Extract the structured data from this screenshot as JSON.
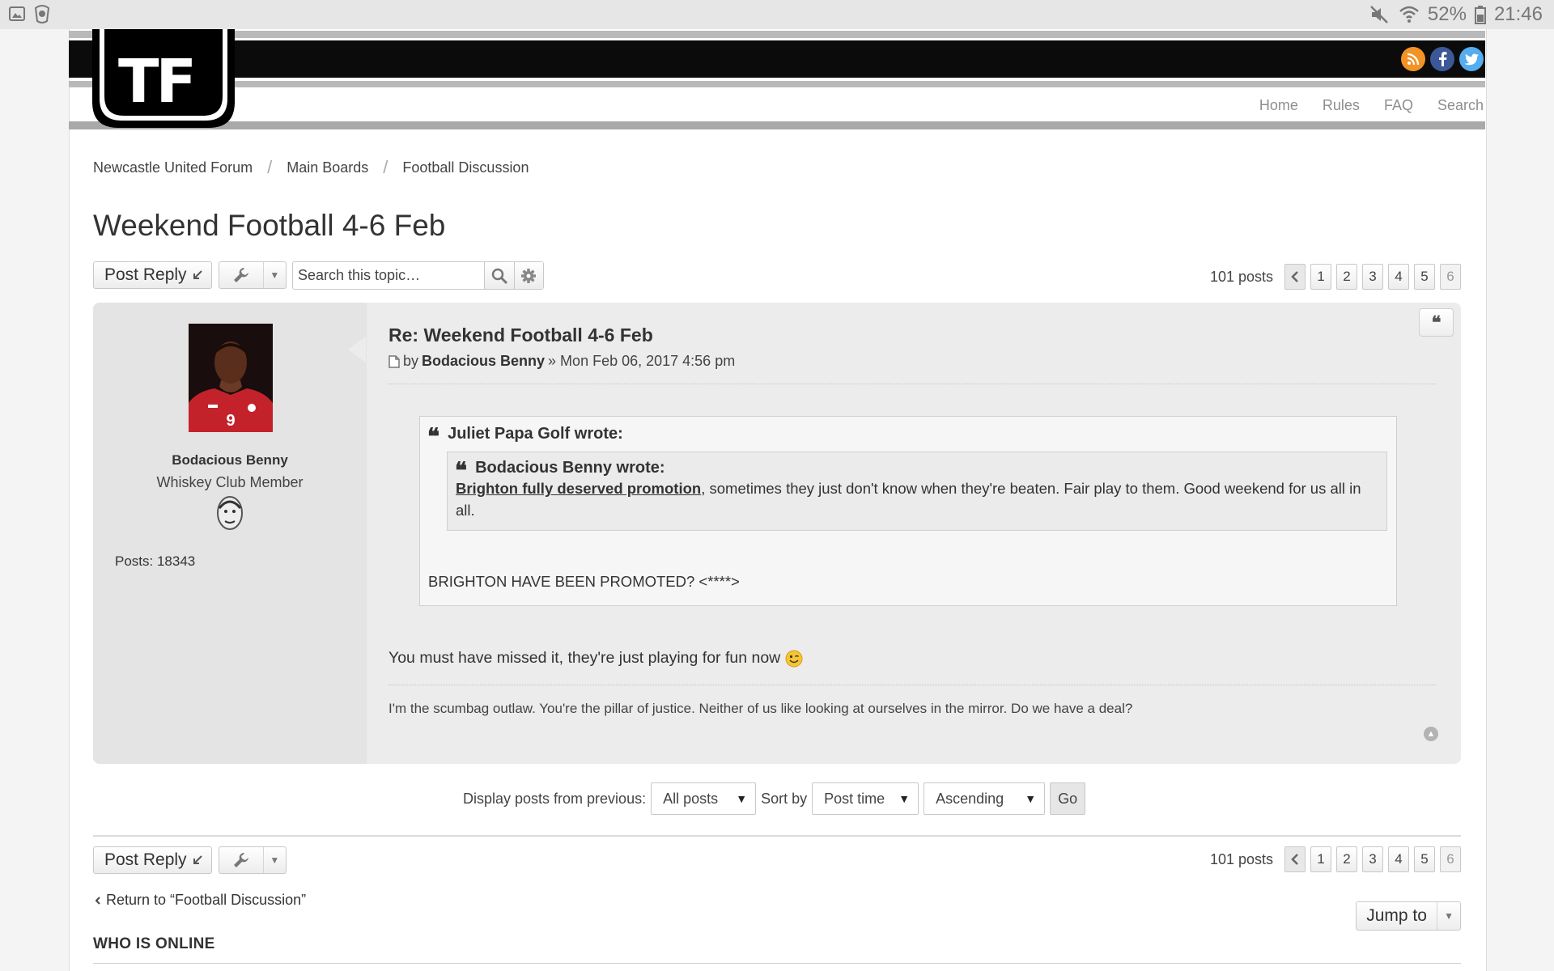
{
  "status_bar": {
    "battery": "52%",
    "time": "21:46"
  },
  "header": {
    "logo_text": "TF",
    "nav": [
      "Home",
      "Rules",
      "FAQ",
      "Search"
    ]
  },
  "breadcrumbs": [
    "Newcastle United Forum",
    "Main Boards",
    "Football Discussion"
  ],
  "topic": {
    "title": "Weekend Football 4-6 Feb",
    "post_reply_label": "Post Reply",
    "search_placeholder": "Search this topic…",
    "post_count": "101 posts",
    "pages": [
      "1",
      "2",
      "3",
      "4",
      "5",
      "6"
    ],
    "current_page": "6"
  },
  "post": {
    "title": "Re: Weekend Football 4-6 Feb",
    "by_label": "by",
    "author": "Bodacious Benny",
    "datetime": "» Mon Feb 06, 2017 4:56 pm",
    "profile": {
      "username": "Bodacious Benny",
      "rank": "Whiskey Club Member",
      "posts": "Posts: 18343"
    },
    "quote_outer": {
      "cite": "Juliet Papa Golf wrote:",
      "text": "BRIGHTON HAVE BEEN PROMOTED? <****>"
    },
    "quote_inner": {
      "cite": "Bodacious Benny wrote:",
      "link_text": "Brighton fully deserved promotion",
      "text": ", sometimes they just don't know when they're beaten. Fair play to them. Good weekend for us all in all."
    },
    "body": "You must have missed it, they're just playing for fun now",
    "signature": "I'm the scumbag outlaw. You're the pillar of justice. Neither of us like looking at ourselves in the mirror. Do we have a deal?"
  },
  "display_options": {
    "display_label": "Display posts from previous:",
    "display_value": "All posts",
    "sort_label": "Sort by",
    "sort_value": "Post time",
    "order_value": "Ascending",
    "go_label": "Go"
  },
  "footer": {
    "return_link": "Return to “Football Discussion”",
    "jump_label": "Jump to",
    "who_online": "WHO IS ONLINE"
  },
  "colors": {
    "rss": "#f39325",
    "facebook": "#3b5998",
    "twitter": "#55acee"
  },
  "icons": [
    "rss-icon",
    "facebook-icon",
    "twitter-icon",
    "wrench-icon",
    "search-icon",
    "gear-icon",
    "quote-icon",
    "post-icon",
    "scroll-top-icon",
    "wink-emoji-icon"
  ]
}
